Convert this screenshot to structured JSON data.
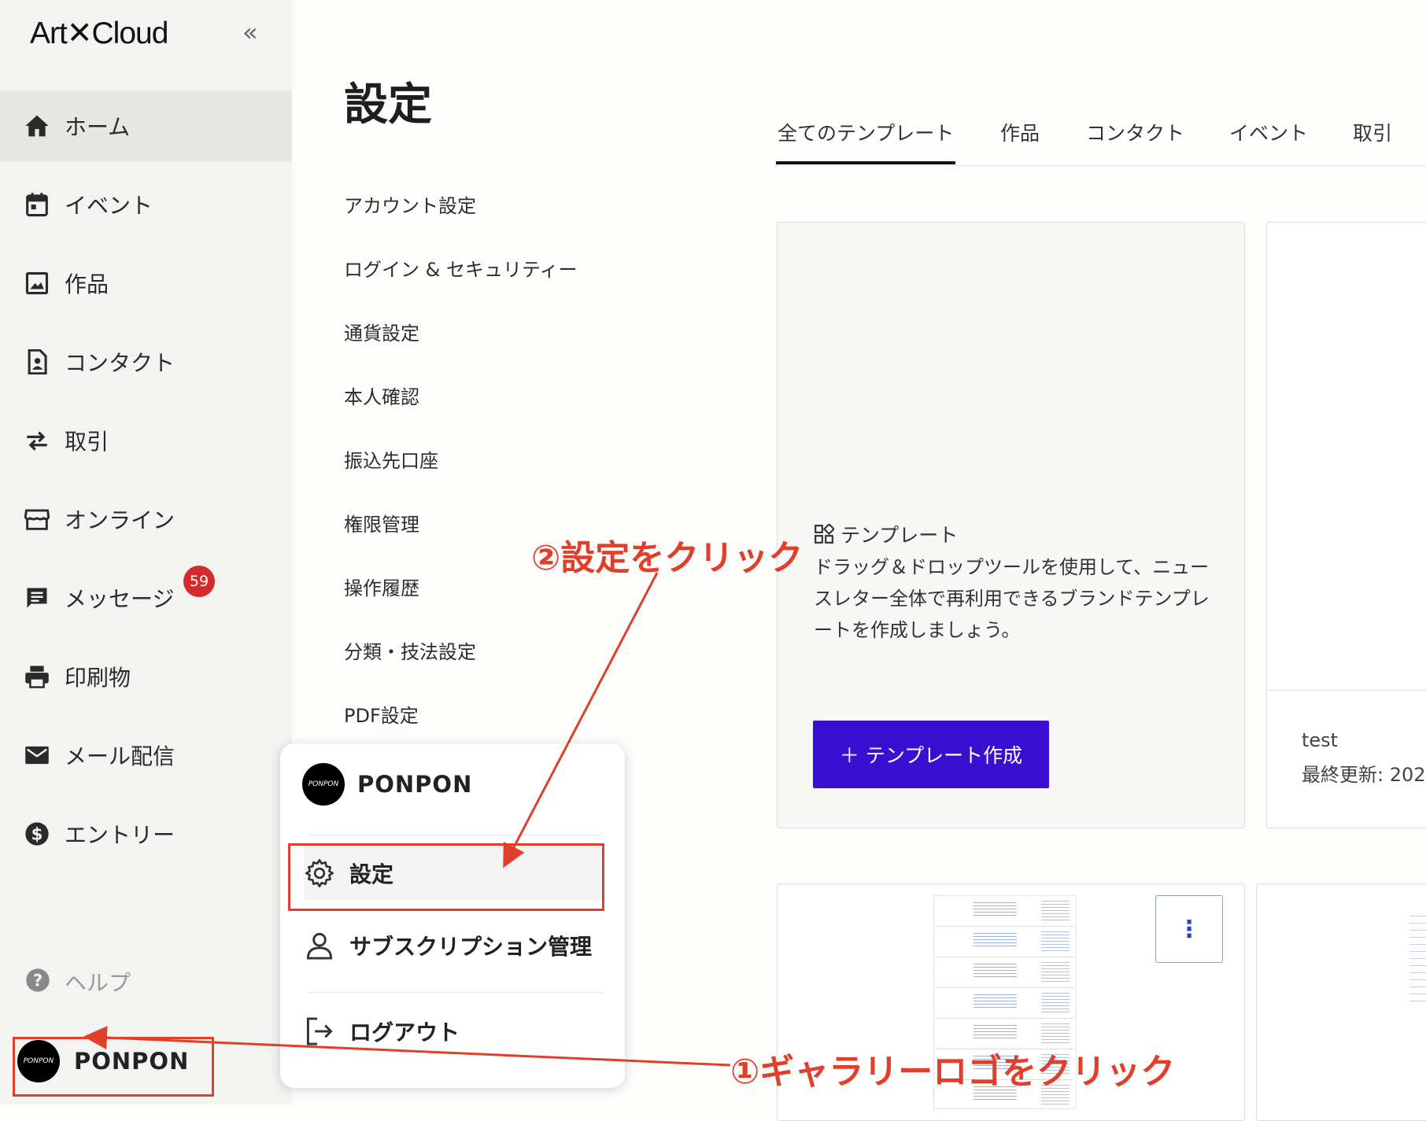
{
  "app": {
    "logo": "Art✕Cloud",
    "collapse_icon": "«"
  },
  "sidebar": {
    "items": [
      {
        "label": "ホーム",
        "icon": "home-icon",
        "active": true
      },
      {
        "label": "イベント",
        "icon": "calendar-icon"
      },
      {
        "label": "作品",
        "icon": "image-icon"
      },
      {
        "label": "コンタクト",
        "icon": "contact-icon"
      },
      {
        "label": "取引",
        "icon": "swap-icon"
      },
      {
        "label": "オンライン",
        "icon": "store-icon"
      },
      {
        "label": "メッセージ",
        "icon": "message-icon",
        "badge": "59"
      },
      {
        "label": "印刷物",
        "icon": "printer-icon"
      },
      {
        "label": "メール配信",
        "icon": "mail-icon"
      },
      {
        "label": "エントリー",
        "icon": "dollar-icon"
      }
    ],
    "help_label": "ヘルプ",
    "user_name": "PONPON",
    "avatar_text": "PONPON"
  },
  "page": {
    "title": "設定"
  },
  "settings_menu": [
    "アカウント設定",
    "ログイン & セキュリティー",
    "通貨設定",
    "本人確認",
    "振込先口座",
    "権限管理",
    "操作履歴",
    "分類・技法設定",
    "PDF設定"
  ],
  "tabs": [
    "全てのテンプレート",
    "作品",
    "コンタクト",
    "イベント",
    "取引"
  ],
  "template_card": {
    "header": "テンプレート",
    "description": "ドラッグ＆ドロップツールを使用して、ニュースレター全体で再利用できるブランドテンプレートを作成しましょう。",
    "button_label": "＋  テンプレート作成"
  },
  "test_card": {
    "name": "test",
    "updated": "最終更新: 202"
  },
  "popup": {
    "user_name": "PONPON",
    "items": [
      {
        "label": "設定",
        "icon": "gear-icon"
      },
      {
        "label": "サブスクリプション管理",
        "icon": "person-icon"
      },
      {
        "label": "ログアウト",
        "icon": "logout-icon"
      }
    ]
  },
  "annotations": {
    "step1": "①ギャラリーロゴをクリック",
    "step2": "②設定をクリック",
    "color": "#e0402a"
  },
  "colors": {
    "accent": "#3a0fd1",
    "badge": "#d42a2a"
  }
}
